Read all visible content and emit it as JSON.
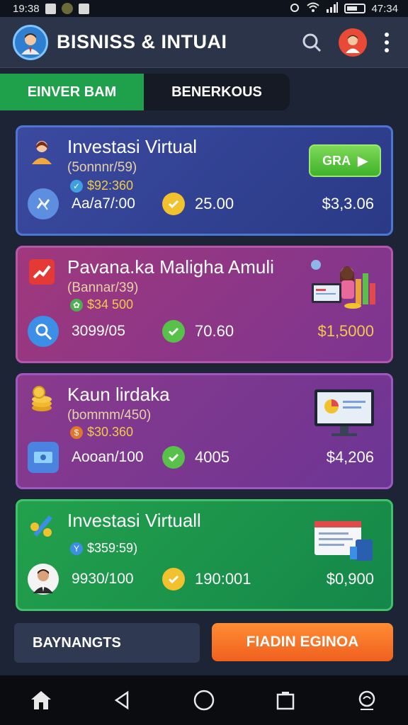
{
  "status_bar": {
    "time": "19:38",
    "clock_right": "47:34"
  },
  "app_bar": {
    "title": "BISNISS & INTUAI",
    "icons": [
      "avatar-icon",
      "search-icon",
      "profile-icon",
      "more-vert-icon"
    ]
  },
  "tabs": [
    {
      "label": "EINVER BAM",
      "active": true
    },
    {
      "label": "BENERKOUS",
      "active": false
    }
  ],
  "cards": [
    {
      "title": "Investasi Virtual",
      "subtitle": "(5onnnr/59)",
      "amount": "$92:360",
      "button_label": "GRA",
      "value1": "Aa/a7/:00",
      "value2": "25.00",
      "total": "$3,3.06",
      "colors": {
        "bg": "#33428f",
        "border": "#4d76d2",
        "total": "#ffffff"
      }
    },
    {
      "title": "Pavana.ka Maligha Amuli",
      "subtitle": "(Bannar/39)",
      "amount": "$34 500",
      "value1": "3099/05",
      "value2": "70.60",
      "total": "$1,5000",
      "colors": {
        "bg": "#90367f",
        "border": "#b357a8",
        "total": "#f2c94c"
      }
    },
    {
      "title": "Kaun lirdaka",
      "subtitle": "(bommm/450)",
      "amount": "$30.360",
      "value1": "Aooan/100",
      "value2": "4005",
      "total": "$4,206",
      "colors": {
        "bg": "#7b3890",
        "border": "#9b59c0",
        "total": "#ffffff"
      }
    },
    {
      "title": "Investasi Virtuall",
      "amount": "$359:59)",
      "value1": "9930/100",
      "value2": "190:001",
      "total": "$0,900",
      "colors": {
        "bg": "#1e944b",
        "border": "#40c26a",
        "total": "#ffffff"
      }
    }
  ],
  "buttons": {
    "left": "BAYNANGTS",
    "right": "FIADIN EGINOA"
  },
  "nav": [
    "home-icon",
    "back-icon",
    "circle-home-icon",
    "recents-icon",
    "assistant-icon"
  ]
}
